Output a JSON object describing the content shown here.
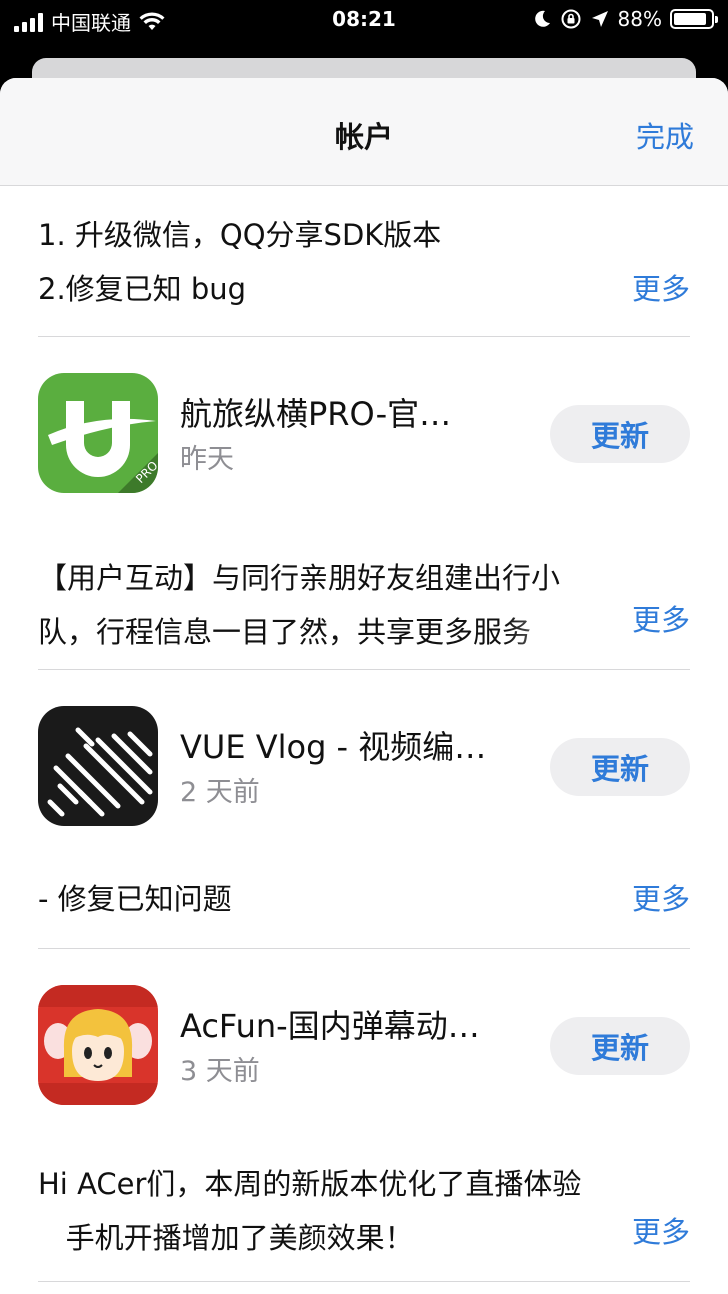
{
  "status": {
    "carrier": "中国联通",
    "time": "08:21",
    "battery": "88%",
    "battery_level": 0.88
  },
  "nav": {
    "title": "帐户",
    "done": "完成"
  },
  "first_notes": {
    "lines": [
      "1. 升级微信，QQ分享SDK版本",
      "2.修复已知 bug"
    ],
    "more": "更多"
  },
  "apps": [
    {
      "name": "航旅纵横PRO-官…",
      "date": "昨天",
      "button": "更新",
      "notes": [
        "【用户互动】与同行亲朋好友组建出行小",
        "队，行程信息一目了然，共享更多服务"
      ],
      "more": "更多"
    },
    {
      "name": "VUE Vlog - 视频编…",
      "date": "2 天前",
      "button": "更新",
      "notes": [
        "- 修复已知问题"
      ],
      "more": "更多"
    },
    {
      "name": "AcFun-国内弹幕动…",
      "date": "3 天前",
      "button": "更新",
      "notes": [
        "Hi ACer们，本周的新版本优化了直播体验",
        "   手机开播增加了美颜效果！"
      ],
      "more": "更多"
    }
  ],
  "colors": {
    "accent": "#2f7bd9",
    "secondary_text": "#8e8e93"
  }
}
